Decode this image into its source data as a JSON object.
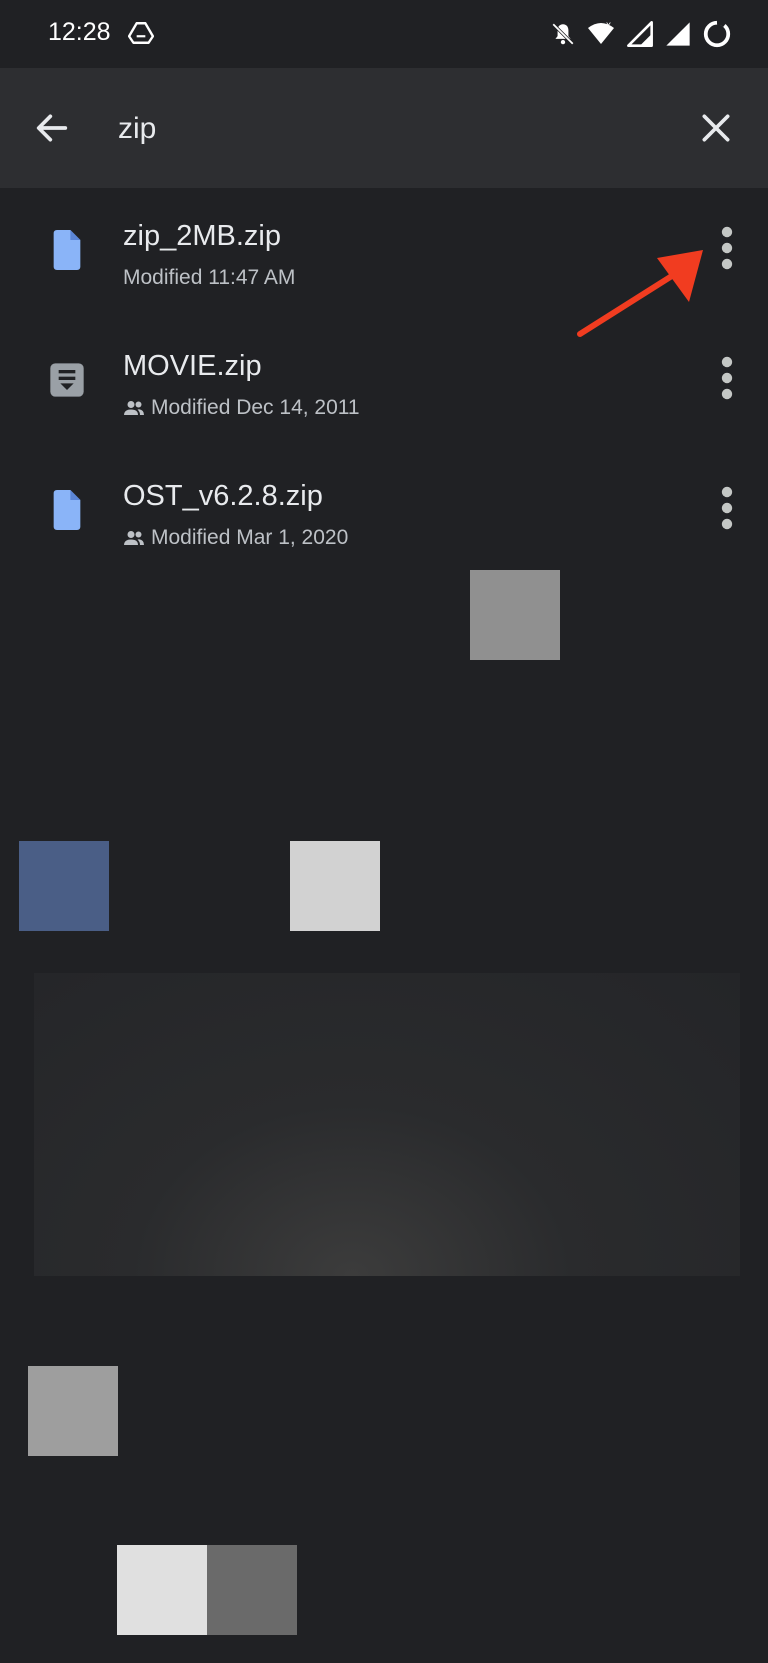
{
  "status_bar": {
    "time": "12:28",
    "icons": [
      "drive-icon",
      "bell-off-icon",
      "wifi-icon",
      "signal-icon",
      "signal-icon",
      "battery-circle-icon"
    ]
  },
  "search": {
    "query": "zip"
  },
  "files": [
    {
      "name": "zip_2MB.zip",
      "modified": "Modified 11:47 AM",
      "shared": false,
      "icon": "file-icon",
      "icon_color": "#8ab4f8"
    },
    {
      "name": "MOVIE.zip",
      "modified": "Modified Dec 14, 2011",
      "shared": true,
      "icon": "archive-icon",
      "icon_color": "#9aa0a6"
    },
    {
      "name": "OST_v6.2.8.zip",
      "modified": "Modified Mar 1, 2020",
      "shared": true,
      "icon": "file-icon",
      "icon_color": "#8ab4f8"
    }
  ],
  "colors": {
    "background": "#202124",
    "search_bar": "#2d2e31",
    "annotation_arrow": "#f13c20"
  }
}
